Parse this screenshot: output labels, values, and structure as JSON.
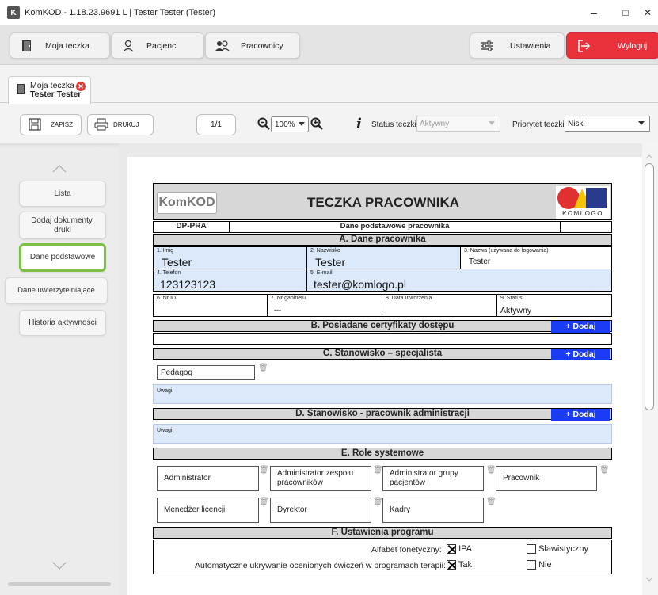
{
  "window": {
    "app_icon_letter": "K",
    "title": "KomKOD - 1.18.23.9691 L | Tester Tester (Tester)",
    "minimize": "–",
    "maximize": "□",
    "close": "✕"
  },
  "topnav": {
    "moja_teczka": "Moja teczka",
    "pacjenci": "Pacjenci",
    "pracownicy": "Pracownicy",
    "ustawienia": "Ustawienia",
    "wyloguj": "Wyloguj"
  },
  "filetab": {
    "line1": "Moja teczka",
    "line2": "Tester Tester",
    "close_symbol": "✕"
  },
  "toolbar": {
    "zapisz": "ZAPISZ",
    "drukuj": "DRUKUJ",
    "page": "1/1",
    "zoom": "100%",
    "status_label": "Status teczki",
    "status_value": "Aktywny",
    "priority_label": "Priorytet teczki:",
    "priority_value": "Niski"
  },
  "sidebar": {
    "items": [
      {
        "label": "Lista"
      },
      {
        "label": "Dodaj dokumenty, druki"
      },
      {
        "label": "Dane podstawowe"
      },
      {
        "label": "Dane uwierzytelniające"
      },
      {
        "label": "Historia aktywności"
      }
    ]
  },
  "form": {
    "logo_text": "KomKOD",
    "heading": "TECZKA PRACOWNIKA",
    "brand_logo_text": "KOMLOGO",
    "code": "DP-PRA",
    "subtitle": "Dane podstawowe pracownika",
    "section_a": "A. Dane pracownika",
    "field_imie_label": "1. Imię",
    "field_imie_value": "Tester",
    "field_nazwisko_label": "2. Nazwisko",
    "field_nazwisko_value": "Tester",
    "field_login_label": "3. Nazwa (używana do logowania)",
    "field_login_value": "Tester",
    "field_telefon_label": "4. Telefon",
    "field_telefon_value": "123123123",
    "field_email_label": "5. E-mail",
    "field_email_value": "tester@komlogo.pl",
    "field_nrid_label": "6. Nr ID",
    "field_gabinet_label": "7. Nr gabinetu",
    "field_gabinet_value": "---",
    "field_data_label": "8. Data utworzenia",
    "field_status_label": "9. Status",
    "field_status_value": "Aktywny",
    "section_b": "B. Posiadane certyfikaty dostępu",
    "section_c": "C. Stanowisko – specjalista",
    "stanowisko_value": "Pedagog",
    "uwagi_label": "Uwagi",
    "section_d": "D. Stanowisko - pracownik administracji",
    "section_e": "E. Role systemowe",
    "roles": [
      "Administrator",
      "Administrator zespołu pracowników",
      "Administrator grupy pacjentów",
      "Pracownik",
      "Menedżer licencji",
      "Dyrektor",
      "Kadry"
    ],
    "section_f": "F. Ustawienia programu",
    "alfabet_label": "Alfabet fonetyczny:",
    "alfabet_opt1": "IPA",
    "alfabet_opt2": "Slawistyczny",
    "auto_label": "Automatyczne ukrywanie ocenionych ćwiczeń w programach terapii:",
    "auto_opt1": "Tak",
    "auto_opt2": "Nie",
    "dodaj_label": "+ Dodaj"
  },
  "colors": {
    "accent_green": "#7bc143",
    "logout_red": "#e8313b",
    "dodaj_blue": "#1a3cf5",
    "field_blue": "#dbe9fb"
  }
}
